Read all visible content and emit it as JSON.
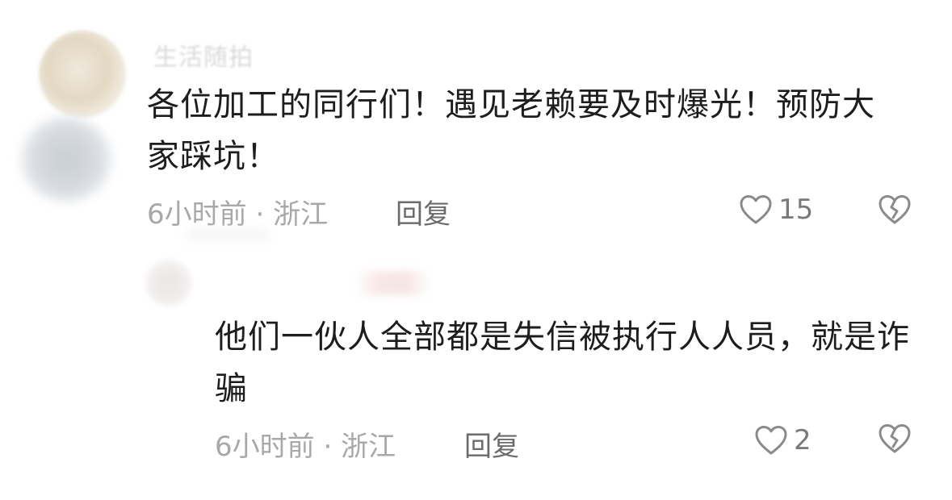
{
  "comments": [
    {
      "username": "生活随拍",
      "text": "各位加工的同行们！遇见老赖要及时爆光！预防大家踩坑！",
      "time": "6小时前",
      "separator": "·",
      "location": "浙江",
      "reply_label": "回复",
      "likes": "15",
      "like_icon": "heart-outline-icon",
      "dislike_icon": "broken-heart-icon"
    },
    {
      "username": "",
      "text": "他们一伙人全部都是失信被执行人人员，就是诈骗",
      "time": "6小时前",
      "separator": "·",
      "location": "浙江",
      "reply_label": "回复",
      "likes": "2",
      "like_icon": "heart-outline-icon",
      "dislike_icon": "broken-heart-icon"
    }
  ],
  "colors": {
    "text": "#1d1d1d",
    "meta": "#a8a8a8",
    "reply": "#6b6b6b",
    "icon": "#8a8a8a"
  }
}
